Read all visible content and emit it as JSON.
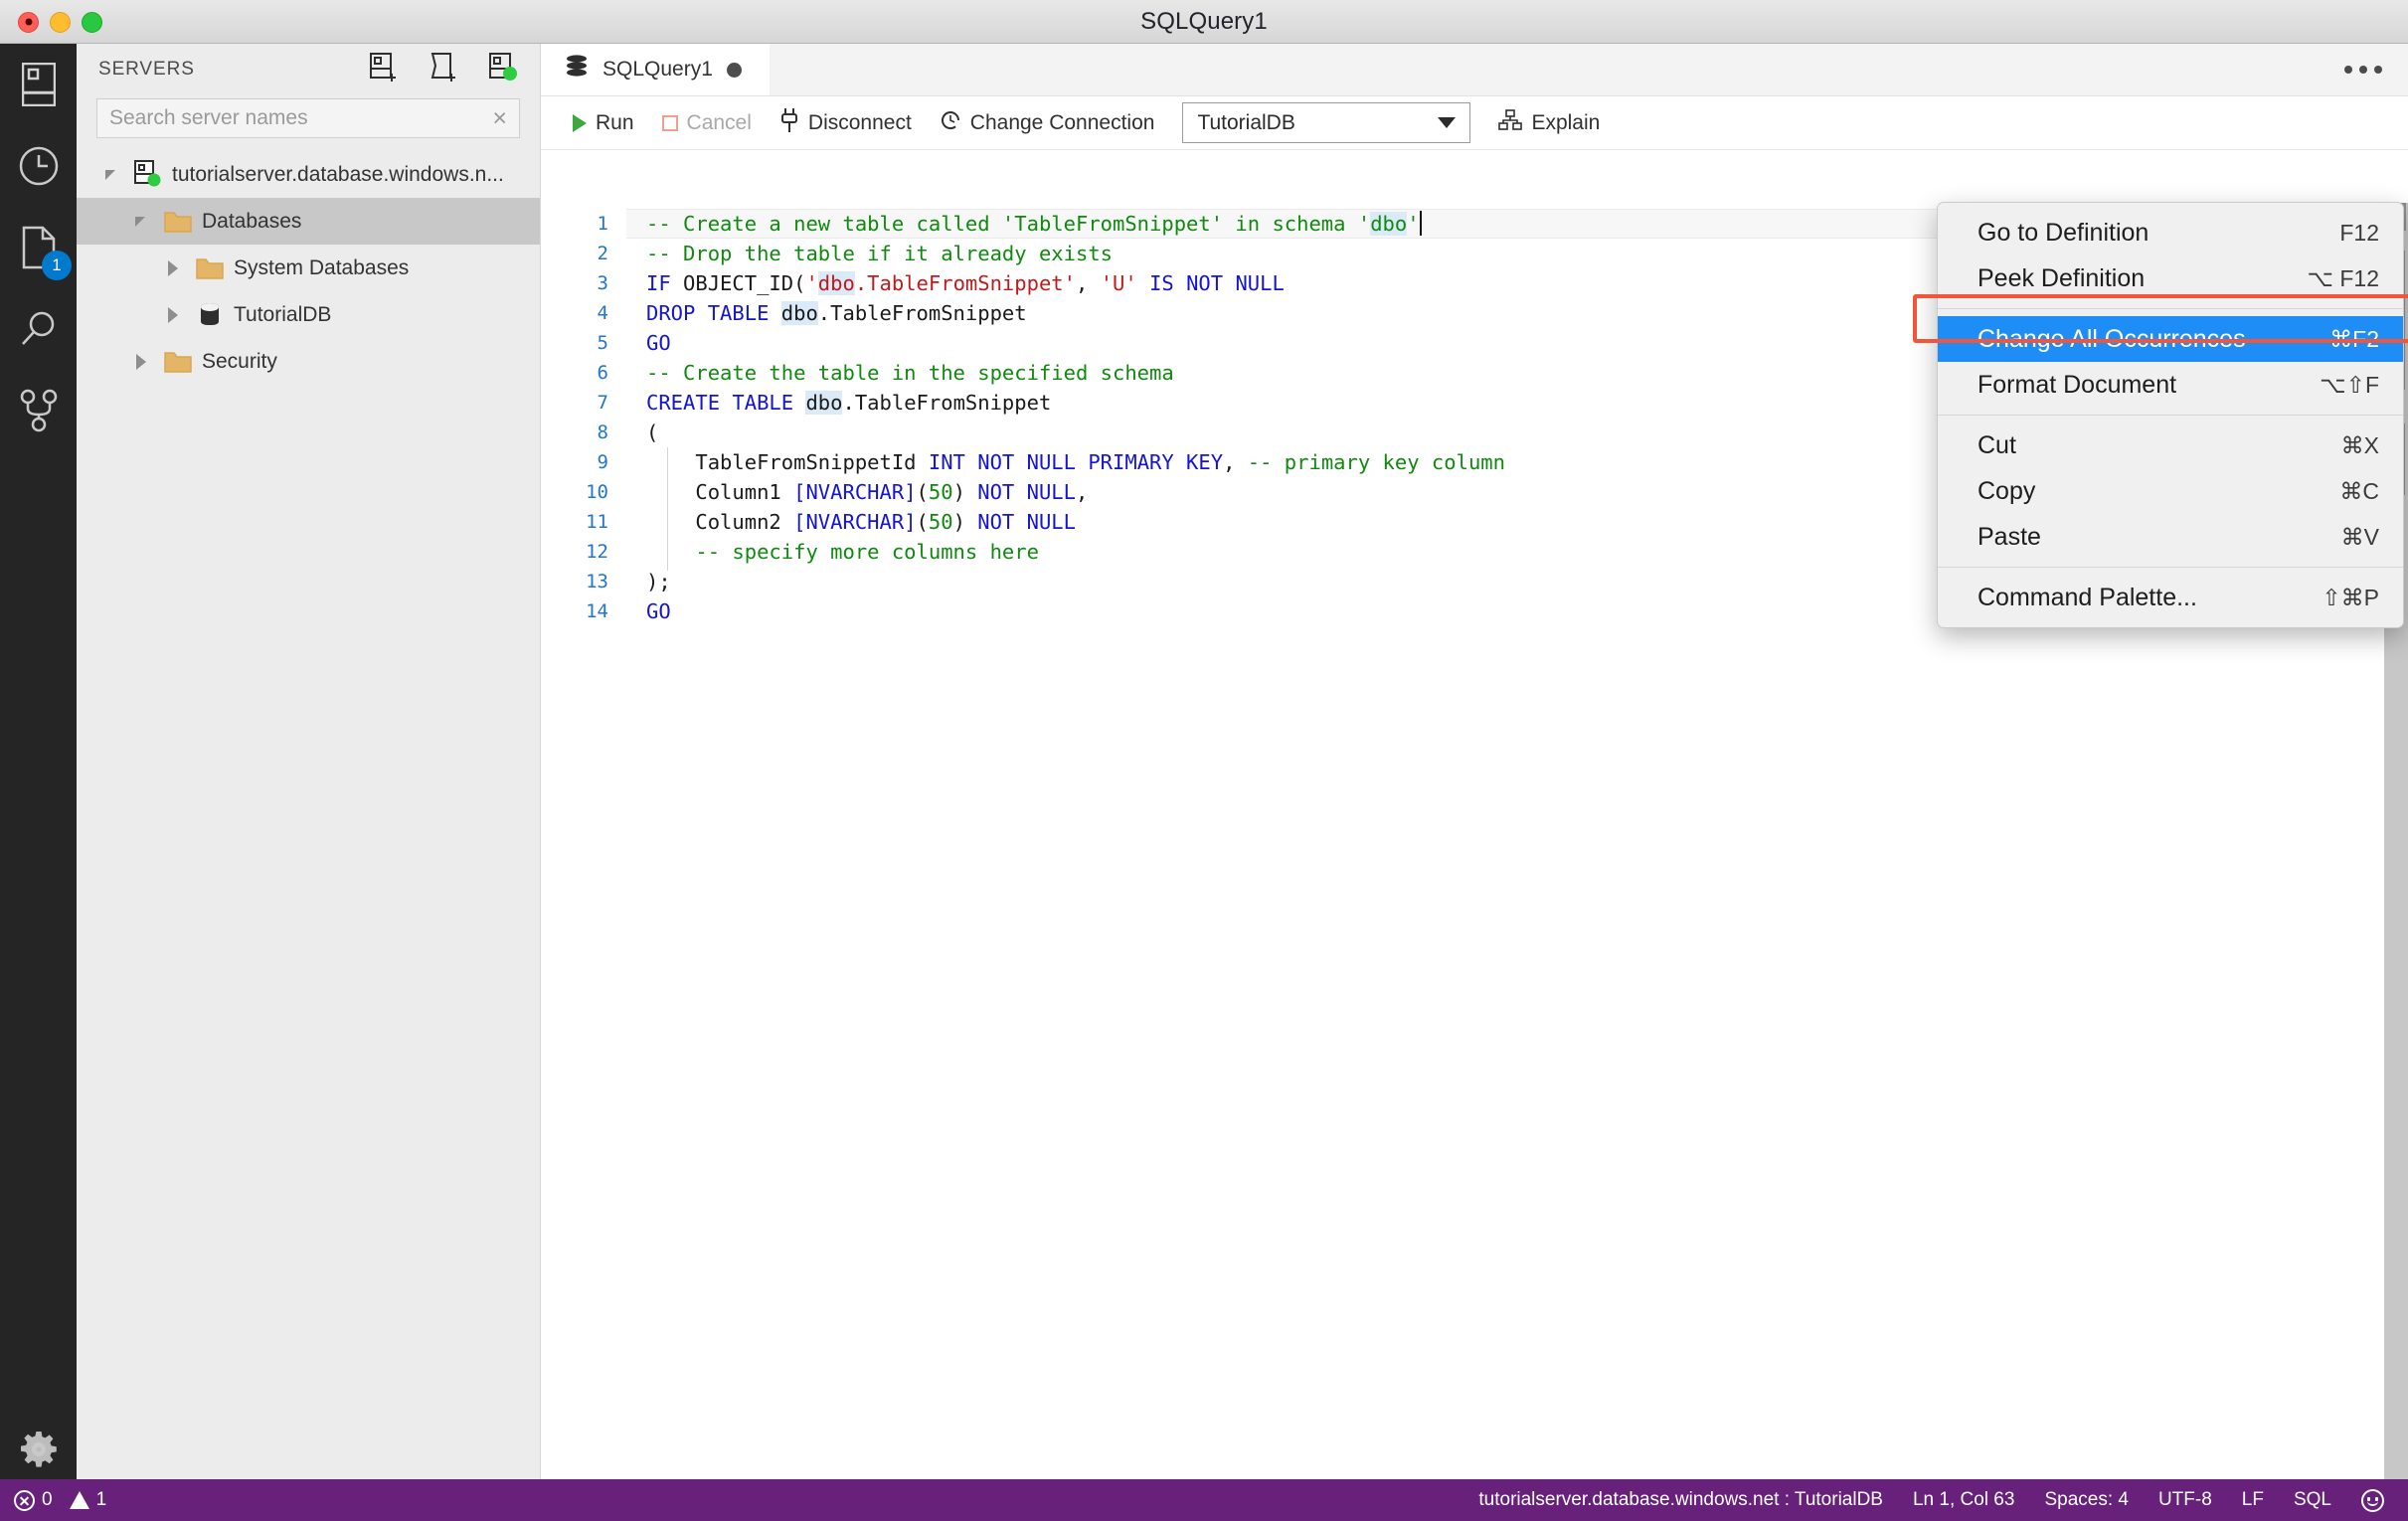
{
  "window": {
    "title": "SQLQuery1",
    "traffic_lights": [
      "close-button",
      "minimize-button",
      "zoom-button"
    ]
  },
  "activity_bar": {
    "items": [
      {
        "name": "servers-icon",
        "label": "Servers"
      },
      {
        "name": "history-icon",
        "label": "Query History"
      },
      {
        "name": "open-editors-icon",
        "label": "Open Editors",
        "badge": "1"
      },
      {
        "name": "search-icon",
        "label": "Search"
      },
      {
        "name": "source-control-icon",
        "label": "Source Control"
      }
    ],
    "settings": {
      "name": "gear-icon",
      "label": "Manage"
    }
  },
  "sidebar": {
    "header": {
      "title": "SERVERS",
      "actions": [
        {
          "name": "new-connection-icon",
          "label": "New Connection"
        },
        {
          "name": "new-query-icon",
          "label": "New Query"
        },
        {
          "name": "new-server-group-icon",
          "label": "New Server Group"
        }
      ]
    },
    "search": {
      "placeholder": "Search server names",
      "value": "",
      "clear_label": "×"
    },
    "tree": [
      {
        "label": "tutorialserver.database.windows.n...",
        "icon": "server-connected-icon",
        "expanded": true,
        "depth": 0,
        "selected": false
      },
      {
        "label": "Databases",
        "icon": "folder-icon",
        "expanded": true,
        "depth": 1,
        "selected": true
      },
      {
        "label": "System Databases",
        "icon": "folder-icon",
        "expanded": false,
        "depth": 2,
        "selected": false
      },
      {
        "label": "TutorialDB",
        "icon": "database-icon",
        "expanded": false,
        "depth": 2,
        "selected": false
      },
      {
        "label": "Security",
        "icon": "folder-icon",
        "expanded": false,
        "depth": 1,
        "selected": false
      }
    ]
  },
  "editor_group": {
    "tab": {
      "label": "SQLQuery1",
      "icon": "database-icon",
      "dirty": true
    },
    "more_actions": "editor-more-actions"
  },
  "query_toolbar": {
    "run": "Run",
    "cancel": "Cancel",
    "disconnect": "Disconnect",
    "change_connection": "Change Connection",
    "database": "TutorialDB",
    "explain": "Explain"
  },
  "code": {
    "lines": [
      {
        "n": "1",
        "tokens": [
          {
            "t": "-- Create a new table called 'TableFromSnippet' in schema '",
            "c": "cmt"
          },
          {
            "t": "dbo",
            "c": "cmt occ"
          },
          {
            "t": "'",
            "c": "cmt"
          }
        ],
        "current": true,
        "caret_after": true
      },
      {
        "n": "2",
        "tokens": [
          {
            "t": "-- Drop the table if it already exists",
            "c": "cmt"
          }
        ]
      },
      {
        "n": "3",
        "tokens": [
          {
            "t": "IF",
            "c": "kw"
          },
          {
            "t": " OBJECT_ID(",
            "c": "plain"
          },
          {
            "t": "'",
            "c": "str"
          },
          {
            "t": "dbo",
            "c": "str occ"
          },
          {
            "t": ".TableFromSnippet'",
            "c": "str"
          },
          {
            "t": ", ",
            "c": "plain"
          },
          {
            "t": "'U'",
            "c": "str"
          },
          {
            "t": " ",
            "c": "plain"
          },
          {
            "t": "IS NOT NULL",
            "c": "kw"
          }
        ]
      },
      {
        "n": "4",
        "tokens": [
          {
            "t": "DROP TABLE",
            "c": "kw"
          },
          {
            "t": " ",
            "c": "plain"
          },
          {
            "t": "dbo",
            "c": "plain occ"
          },
          {
            "t": ".TableFromSnippet",
            "c": "plain"
          }
        ]
      },
      {
        "n": "5",
        "tokens": [
          {
            "t": "GO",
            "c": "kw"
          }
        ]
      },
      {
        "n": "6",
        "tokens": [
          {
            "t": "-- Create the table in the specified schema",
            "c": "cmt"
          }
        ]
      },
      {
        "n": "7",
        "tokens": [
          {
            "t": "CREATE TABLE",
            "c": "kw"
          },
          {
            "t": " ",
            "c": "plain"
          },
          {
            "t": "dbo",
            "c": "plain occ"
          },
          {
            "t": ".TableFromSnippet",
            "c": "plain"
          }
        ]
      },
      {
        "n": "8",
        "tokens": [
          {
            "t": "(",
            "c": "plain"
          }
        ]
      },
      {
        "n": "9",
        "tokens": [
          {
            "t": "    TableFromSnippetId ",
            "c": "plain"
          },
          {
            "t": "INT NOT NULL PRIMARY KEY",
            "c": "kw"
          },
          {
            "t": ", ",
            "c": "plain"
          },
          {
            "t": "-- primary key column",
            "c": "cmt"
          }
        ]
      },
      {
        "n": "10",
        "tokens": [
          {
            "t": "    Column1 ",
            "c": "plain"
          },
          {
            "t": "[NVARCHAR]",
            "c": "kw"
          },
          {
            "t": "(",
            "c": "plain"
          },
          {
            "t": "50",
            "c": "num"
          },
          {
            "t": ") ",
            "c": "plain"
          },
          {
            "t": "NOT NULL",
            "c": "kw"
          },
          {
            "t": ",",
            "c": "plain"
          }
        ]
      },
      {
        "n": "11",
        "tokens": [
          {
            "t": "    Column2 ",
            "c": "plain"
          },
          {
            "t": "[NVARCHAR]",
            "c": "kw"
          },
          {
            "t": "(",
            "c": "plain"
          },
          {
            "t": "50",
            "c": "num"
          },
          {
            "t": ") ",
            "c": "plain"
          },
          {
            "t": "NOT NULL",
            "c": "kw"
          }
        ]
      },
      {
        "n": "12",
        "tokens": [
          {
            "t": "    -- specify more columns here",
            "c": "cmt"
          }
        ]
      },
      {
        "n": "13",
        "tokens": [
          {
            "t": ");",
            "c": "plain"
          }
        ]
      },
      {
        "n": "14",
        "tokens": [
          {
            "t": "GO",
            "c": "kw"
          }
        ]
      }
    ]
  },
  "context_menu": {
    "items": [
      {
        "label": "Go to Definition",
        "shortcut": "F12",
        "active": false,
        "separator_after": false
      },
      {
        "label": "Peek Definition",
        "shortcut": "⌥ F12",
        "active": false,
        "separator_after": true
      },
      {
        "label": "Change All Occurrences",
        "shortcut": "⌘F2",
        "active": true,
        "separator_after": false
      },
      {
        "label": "Format Document",
        "shortcut": "⌥⇧F",
        "active": false,
        "separator_after": true
      },
      {
        "label": "Cut",
        "shortcut": "⌘X",
        "active": false,
        "separator_after": false
      },
      {
        "label": "Copy",
        "shortcut": "⌘C",
        "active": false,
        "separator_after": false
      },
      {
        "label": "Paste",
        "shortcut": "⌘V",
        "active": false,
        "separator_after": true
      },
      {
        "label": "Command Palette...",
        "shortcut": "⇧⌘P",
        "active": false,
        "separator_after": false
      }
    ],
    "highlight_color": "#f1563b",
    "active_color": "#1e8ef6"
  },
  "status_bar": {
    "errors": "0",
    "warnings": "1",
    "connection": "tutorialserver.database.windows.net : TutorialDB",
    "cursor": "Ln 1, Col 63",
    "spaces": "Spaces: 4",
    "encoding": "UTF-8",
    "eol": "LF",
    "language": "SQL",
    "feedback": "feedback-smiley-icon",
    "background": "#68217a"
  }
}
